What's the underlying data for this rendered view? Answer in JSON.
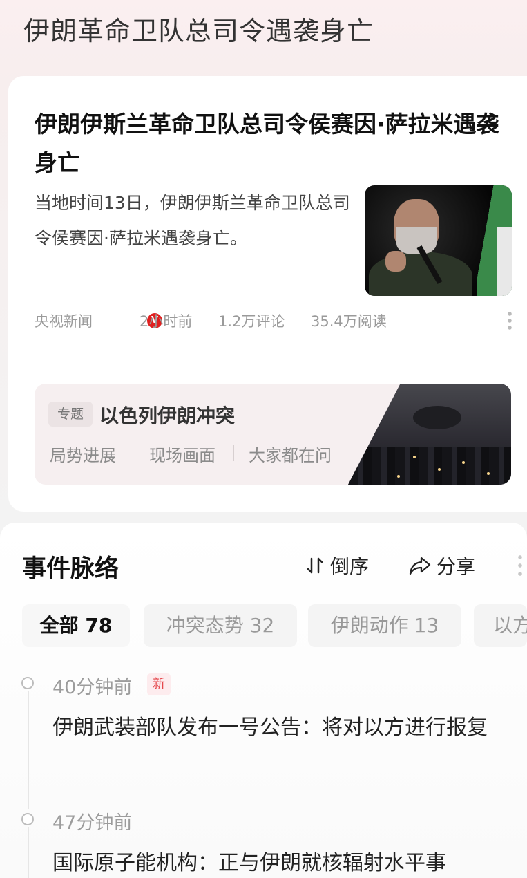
{
  "page": {
    "title": "伊朗革命卫队总司令遇袭身亡"
  },
  "article": {
    "headline": "伊朗伊斯兰革命卫队总司令侯赛因·萨拉米遇袭身亡",
    "summary": "当地时间13日，伊朗伊斯兰革命卫队总司令侯赛因·萨拉米遇袭身亡。",
    "source": "央视新闻",
    "verified_badge": "V",
    "time": "2小时前",
    "comments": "1.2万评论",
    "reads": "35.4万阅读",
    "thumbnail_icon": "speaker-photo"
  },
  "topic": {
    "tag": "专题",
    "title": "以色列伊朗冲突",
    "links": [
      "局势进展",
      "现场画面",
      "大家都在问"
    ],
    "image_icon": "city-night-smoke-photo"
  },
  "events": {
    "title": "事件脉络",
    "sort_label": "倒序",
    "share_label": "分享",
    "tabs": [
      "全部 78",
      "冲突态势 32",
      "伊朗动作 13",
      "以方"
    ],
    "items": [
      {
        "time": "40分钟前",
        "badge": "新",
        "text": "伊朗武装部队发布一号公告：将对以方进行报复"
      },
      {
        "time": "47分钟前",
        "badge": "",
        "text": "国际原子能机构：正与伊朗就核辐射水平事"
      }
    ]
  },
  "colors": {
    "accent_red": "#e02020",
    "new_badge": "#e5484d",
    "card_bg": "#ffffff",
    "topic_bg": "#f6eff0"
  }
}
